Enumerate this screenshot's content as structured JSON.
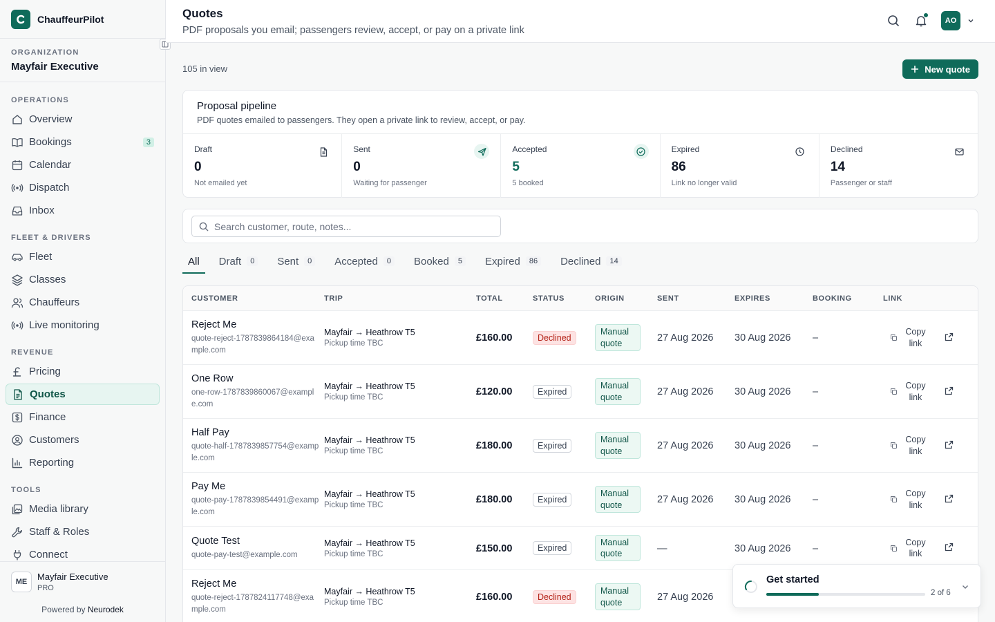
{
  "app": {
    "name": "ChauffeurPilot"
  },
  "organization": {
    "label": "ORGANIZATION",
    "name": "Mayfair Executive"
  },
  "nav": [
    {
      "section": "OPERATIONS",
      "items": [
        {
          "label": "Overview",
          "icon": "home-icon"
        },
        {
          "label": "Bookings",
          "icon": "book-icon",
          "badge": "3"
        },
        {
          "label": "Calendar",
          "icon": "calendar-icon"
        },
        {
          "label": "Dispatch",
          "icon": "radio-icon"
        },
        {
          "label": "Inbox",
          "icon": "inbox-icon"
        }
      ]
    },
    {
      "section": "FLEET & DRIVERS",
      "items": [
        {
          "label": "Fleet",
          "icon": "car-icon"
        },
        {
          "label": "Classes",
          "icon": "layers-icon"
        },
        {
          "label": "Chauffeurs",
          "icon": "users-icon"
        },
        {
          "label": "Live monitoring",
          "icon": "radio-icon"
        }
      ]
    },
    {
      "section": "REVENUE",
      "items": [
        {
          "label": "Pricing",
          "icon": "pound-icon"
        },
        {
          "label": "Quotes",
          "icon": "document-icon",
          "active": true
        },
        {
          "label": "Finance",
          "icon": "dollar-icon"
        },
        {
          "label": "Customers",
          "icon": "user-circle-icon"
        },
        {
          "label": "Reporting",
          "icon": "chart-icon"
        }
      ]
    },
    {
      "section": "TOOLS",
      "items": [
        {
          "label": "Media library",
          "icon": "image-icon"
        },
        {
          "label": "Staff & Roles",
          "icon": "wrench-icon"
        },
        {
          "label": "Connect",
          "icon": "plug-icon"
        }
      ]
    }
  ],
  "footer": {
    "initials": "ME",
    "name": "Mayfair Executive",
    "plan": "PRO",
    "powered_prefix": "Powered by",
    "powered_brand": "Neurodek"
  },
  "header": {
    "title": "Quotes",
    "subtitle": "PDF proposals you email; passengers review, accept, or pay on a private link",
    "user_initials": "AO"
  },
  "toolbar": {
    "count": "105 in view",
    "new_label": "New quote"
  },
  "pipeline": {
    "title": "Proposal pipeline",
    "description": "PDF quotes emailed to passengers. They open a private link to review, accept, or pay.",
    "stats": [
      {
        "label": "Draft",
        "value": "0",
        "sub": "Not emailed yet",
        "icon": "file-icon"
      },
      {
        "label": "Sent",
        "value": "0",
        "sub": "Waiting for passenger",
        "icon": "send-icon"
      },
      {
        "label": "Accepted",
        "value": "5",
        "sub": "5 booked",
        "icon": "check-circle-icon"
      },
      {
        "label": "Expired",
        "value": "86",
        "sub": "Link no longer valid",
        "icon": "clock-icon"
      },
      {
        "label": "Declined",
        "value": "14",
        "sub": "Passenger or staff",
        "icon": "mail-icon"
      }
    ]
  },
  "search": {
    "placeholder": "Search customer, route, notes..."
  },
  "tabs": [
    {
      "label": "All",
      "active": true
    },
    {
      "label": "Draft",
      "count": "0"
    },
    {
      "label": "Sent",
      "count": "0"
    },
    {
      "label": "Accepted",
      "count": "0"
    },
    {
      "label": "Booked",
      "count": "5"
    },
    {
      "label": "Expired",
      "count": "86"
    },
    {
      "label": "Declined",
      "count": "14"
    }
  ],
  "table": {
    "headers": [
      "CUSTOMER",
      "TRIP",
      "TOTAL",
      "STATUS",
      "ORIGIN",
      "SENT",
      "EXPIRES",
      "BOOKING",
      "LINK"
    ],
    "copy_label": "Copy link",
    "rows": [
      {
        "name": "Reject Me",
        "email": "quote-reject-1787839864184@example.com",
        "trip": "Mayfair → Heathrow T5",
        "trip_sub": "Pickup time TBC",
        "total": "£160.00",
        "status": "Declined",
        "origin": "Manual quote",
        "sent": "27 Aug 2026",
        "expires": "30 Aug 2026",
        "booking": "–"
      },
      {
        "name": "One Row",
        "email": "one-row-1787839860067@example.com",
        "trip": "Mayfair → Heathrow T5",
        "trip_sub": "Pickup time TBC",
        "total": "£120.00",
        "status": "Expired",
        "origin": "Manual quote",
        "sent": "27 Aug 2026",
        "expires": "30 Aug 2026",
        "booking": "–"
      },
      {
        "name": "Half Pay",
        "email": "quote-half-1787839857754@example.com",
        "trip": "Mayfair → Heathrow T5",
        "trip_sub": "Pickup time TBC",
        "total": "£180.00",
        "status": "Expired",
        "origin": "Manual quote",
        "sent": "27 Aug 2026",
        "expires": "30 Aug 2026",
        "booking": "–"
      },
      {
        "name": "Pay Me",
        "email": "quote-pay-1787839854491@example.com",
        "trip": "Mayfair → Heathrow T5",
        "trip_sub": "Pickup time TBC",
        "total": "£180.00",
        "status": "Expired",
        "origin": "Manual quote",
        "sent": "27 Aug 2026",
        "expires": "30 Aug 2026",
        "booking": "–"
      },
      {
        "name": "Quote Test",
        "email": "quote-pay-test@example.com",
        "trip": "Mayfair → Heathrow T5",
        "trip_sub": "Pickup time TBC",
        "total": "£150.00",
        "status": "Expired",
        "origin": "Manual quote",
        "sent": "—",
        "expires": "30 Aug 2026",
        "booking": "–"
      },
      {
        "name": "Reject Me",
        "email": "quote-reject-1787824117748@example.com",
        "trip": "Mayfair → Heathrow T5",
        "trip_sub": "Pickup time TBC",
        "total": "£160.00",
        "status": "Declined",
        "origin": "Manual quote",
        "sent": "27 Aug 2026",
        "expires": "",
        "booking": ""
      }
    ]
  },
  "get_started": {
    "title": "Get started",
    "step": "2 of 6",
    "progress": 0.33
  },
  "colors": {
    "accent": "#0f6b5a",
    "declined": "#b42318"
  }
}
